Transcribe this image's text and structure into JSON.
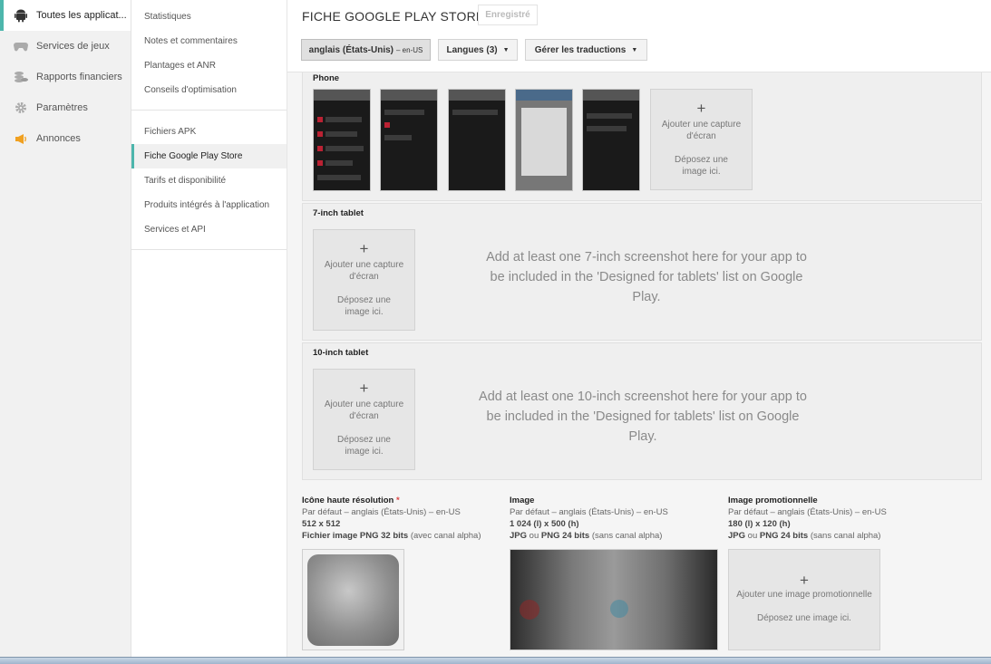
{
  "left_nav": {
    "items": [
      {
        "label": "Toutes les applicat...",
        "icon": "android-icon"
      },
      {
        "label": "Services de jeux",
        "icon": "gamepad-icon"
      },
      {
        "label": "Rapports financiers",
        "icon": "coins-icon"
      },
      {
        "label": "Paramètres",
        "icon": "gear-icon"
      },
      {
        "label": "Annonces",
        "icon": "megaphone-icon"
      }
    ]
  },
  "sub_nav": {
    "group1": [
      {
        "label": "Statistiques"
      },
      {
        "label": "Notes et commentaires"
      },
      {
        "label": "Plantages et ANR"
      },
      {
        "label": "Conseils d'optimisation"
      }
    ],
    "group2": [
      {
        "label": "Fichiers APK"
      },
      {
        "label": "Fiche Google Play Store"
      },
      {
        "label": "Tarifs et disponibilité"
      },
      {
        "label": "Produits intégrés à l'application"
      },
      {
        "label": "Services et API"
      }
    ]
  },
  "header": {
    "title": "FICHE GOOGLE PLAY STORE",
    "saved_label": "Enregistré",
    "language_button": "anglais (États-Unis)",
    "language_code": "– en-US",
    "languages_button": "Langues (3)",
    "translations_button": "Gérer les traductions"
  },
  "phone": {
    "title": "Phone",
    "add_plus": "+",
    "add_caption": "Ajouter une capture d'écran",
    "drop_caption": "Déposez une image ici."
  },
  "tablet7": {
    "title": "7-inch tablet",
    "add_plus": "+",
    "add_caption": "Ajouter une capture d'écran",
    "drop_caption": "Déposez une image ici.",
    "hint": "Add at least one 7-inch screenshot here for your app to be included in the 'Designed for tablets' list on Google Play."
  },
  "tablet10": {
    "title": "10-inch tablet",
    "add_plus": "+",
    "add_caption": "Ajouter une capture d'écran",
    "drop_caption": "Déposez une image ici.",
    "hint": "Add at least one 10-inch screenshot here for your app to be included in the 'Designed for tablets' list on Google Play."
  },
  "assets": {
    "icon": {
      "title": "Icône haute résolution",
      "required": "*",
      "default": "Par défaut – anglais (États-Unis) – en-US",
      "size": "512 x 512",
      "format_bold": "Fichier image PNG 32 bits",
      "format_rest": " (avec canal alpha)"
    },
    "feature": {
      "title": "Image",
      "default": "Par défaut – anglais (États-Unis) – en-US",
      "size": "1 024 (l) x 500 (h)",
      "format_a": "JPG",
      "format_or": " ou ",
      "format_b": "PNG 24 bits",
      "format_rest": " (sans canal alpha)"
    },
    "promo": {
      "title": "Image promotionnelle",
      "default": "Par défaut – anglais (États-Unis) – en-US",
      "size": "180 (l) x 120 (h)",
      "format_a": "JPG",
      "format_or": " ou ",
      "format_b": "PNG 24 bits",
      "format_rest": " (sans canal alpha)",
      "add_plus": "+",
      "add_caption": "Ajouter une image promotionnelle",
      "drop_caption": "Déposez une image ici."
    }
  },
  "colors": {
    "accent": "#4db6ac",
    "required": "#dd4444"
  }
}
